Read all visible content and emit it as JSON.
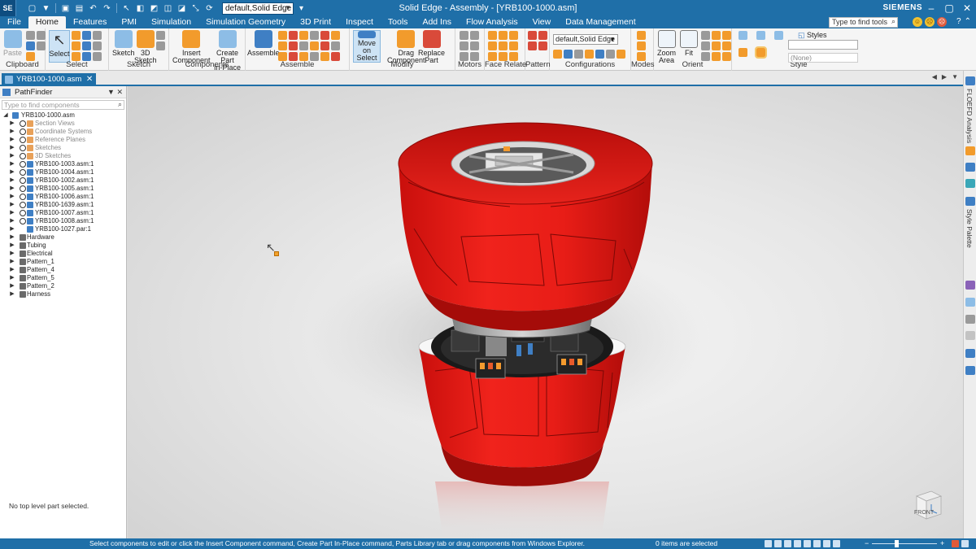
{
  "app": {
    "logo": "SE",
    "window_title": "Solid Edge - Assembly - [YRB100-1000.asm]",
    "brand": "SIEMENS",
    "configuration": "default,Solid Edge",
    "find_tools_placeholder": "Type to find tools",
    "accent": "#1f6fa8"
  },
  "menu": {
    "tabs": [
      "File",
      "Home",
      "Features",
      "PMI",
      "Simulation",
      "Simulation Geometry",
      "3D Print",
      "Inspect",
      "Tools",
      "Add Ins",
      "Flow Analysis",
      "View",
      "Data Management"
    ],
    "active": "Home"
  },
  "ribbon": {
    "groups": {
      "clipboard": "Clipboard",
      "select": "Select",
      "sketch": "Sketch",
      "components": "Components",
      "assemble": "Assemble",
      "modify": "Modify",
      "motors": "Motors",
      "face_relate": "Face Relate",
      "pattern": "Pattern",
      "configurations": "Configurations",
      "modes": "Modes",
      "orient": "Orient",
      "style": "Style"
    },
    "buttons": {
      "paste": "Paste",
      "select": "Select",
      "sketch": "Sketch",
      "sketch3d_1": "3D",
      "sketch3d_2": "Sketch",
      "insert_component_1": "Insert",
      "insert_component_2": "Component",
      "create_part_1": "Create Part",
      "create_part_2": "In-Place",
      "assemble": "Assemble",
      "move_on_select_1": "Move on",
      "move_on_select_2": "Select",
      "drag_component_1": "Drag",
      "drag_component_2": "Component",
      "replace_part_1": "Replace",
      "replace_part_2": "Part",
      "zoom_area_1": "Zoom",
      "zoom_area_2": "Area",
      "fit": "Fit",
      "styles": "Styles",
      "styles_none": "(None)"
    },
    "config_value": "default,Solid Edge"
  },
  "document": {
    "tab": "YRB100-1000.asm"
  },
  "pathfinder": {
    "title": "PathFinder",
    "search_placeholder": "Type to find components",
    "root": "YRB100-1000.asm",
    "items": [
      {
        "label": "Section Views",
        "dim": true
      },
      {
        "label": "Coordinate Systems",
        "dim": true
      },
      {
        "label": "Reference Planes",
        "dim": true
      },
      {
        "label": "Sketches",
        "dim": true
      },
      {
        "label": "3D Sketches",
        "dim": true
      },
      {
        "label": "YRB100-1003.asm:1",
        "dim": false
      },
      {
        "label": "YRB100-1004.asm:1",
        "dim": false
      },
      {
        "label": "YRB100-1002.asm:1",
        "dim": false
      },
      {
        "label": "YRB100-1005.asm:1",
        "dim": false
      },
      {
        "label": "YRB100-1006.asm:1",
        "dim": false
      },
      {
        "label": "YRB100-1639.asm:1",
        "dim": false
      },
      {
        "label": "YRB100-1007.asm:1",
        "dim": false
      },
      {
        "label": "YRB100-1008.asm:1",
        "dim": false
      },
      {
        "label": "YRB100-1027.par:1",
        "dim": false
      }
    ],
    "groups": [
      "Hardware",
      "Tubing",
      "Electrical",
      "Pattern_1",
      "Pattern_4",
      "Pattern_5",
      "Pattern_2",
      "Harness"
    ],
    "status": "No top level part selected."
  },
  "viewport": {
    "view_cube_label": "FRONT",
    "model_color": "#e8201a"
  },
  "right_dock": {
    "flow_analysis": "FLOEFD Analysis",
    "style_palette": "Style Palette"
  },
  "status_bar": {
    "message": "Select components to edit or click the Insert Component command, Create Part In-Place command, Parts Library tab or drag components from Windows Explorer.",
    "selection": "0 items are selected"
  }
}
